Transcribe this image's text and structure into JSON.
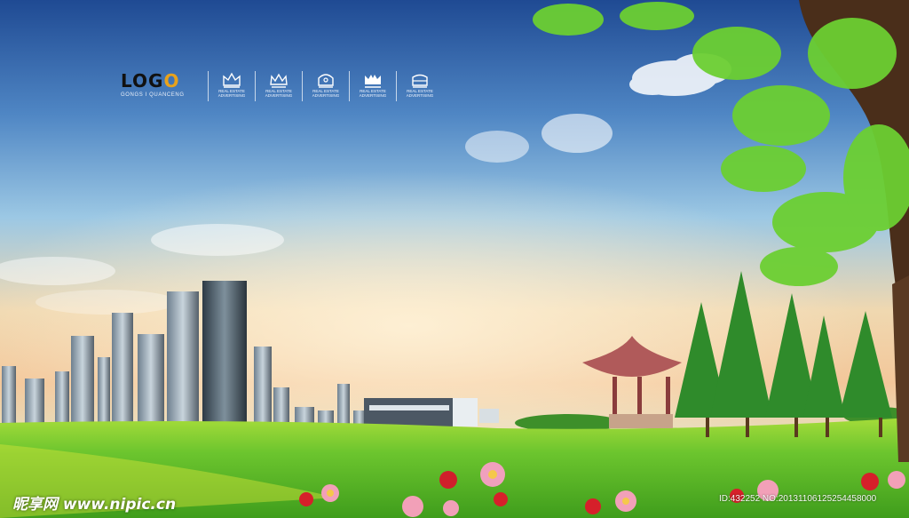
{
  "logo": {
    "title": "LOGO",
    "subtitle": "GONGS I QUANCENG"
  },
  "badges": [
    {
      "icon": "crown-icon",
      "text_top": "REAL ESTATE",
      "text_bottom": "ADVERTISING"
    },
    {
      "icon": "crown-icon",
      "text_top": "REAL ESTATE",
      "text_bottom": "ADVERTISING"
    },
    {
      "icon": "crown-icon",
      "text_top": "REAL ESTATE",
      "text_bottom": "ADVERTISING"
    },
    {
      "icon": "crown-icon",
      "text_top": "REAL ESTATE",
      "text_bottom": "ADVERTISING"
    },
    {
      "icon": "crown-icon",
      "text_top": "REAL ESTATE",
      "text_bottom": "ADVERTISING"
    }
  ],
  "watermark": {
    "left": "昵享网 www.nipic.cn",
    "right": "ID:432252 NO:20131106125254458000"
  },
  "colors": {
    "sky_top": "#1f4a93",
    "sky_mid": "#8fc3e6",
    "sky_glow": "#f3c79a",
    "grass": "#5fbf2a",
    "grass_light": "#a6dc3a",
    "logo_accent": "#e8a21c"
  }
}
